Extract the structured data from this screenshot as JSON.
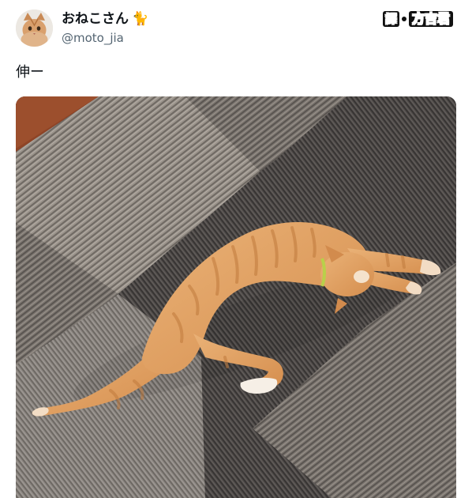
{
  "user": {
    "display_name": "おねこさん",
    "name_emoji": "🐈",
    "handle": "@moto_jia",
    "avatar_icon": "cat-avatar-icon"
  },
  "watermark": {
    "seal": "譯",
    "text": "方吉君"
  },
  "tweet": {
    "text": "伸ー"
  },
  "media": {
    "description_icon": "cat-photo"
  },
  "colors": {
    "text_primary": "#0f1419",
    "text_secondary": "#536471",
    "cat_fur": "#e2a063",
    "carpet_dark": "#4a4644",
    "carpet_light": "#8d857d",
    "floor_wood": "#9a4a2a"
  }
}
